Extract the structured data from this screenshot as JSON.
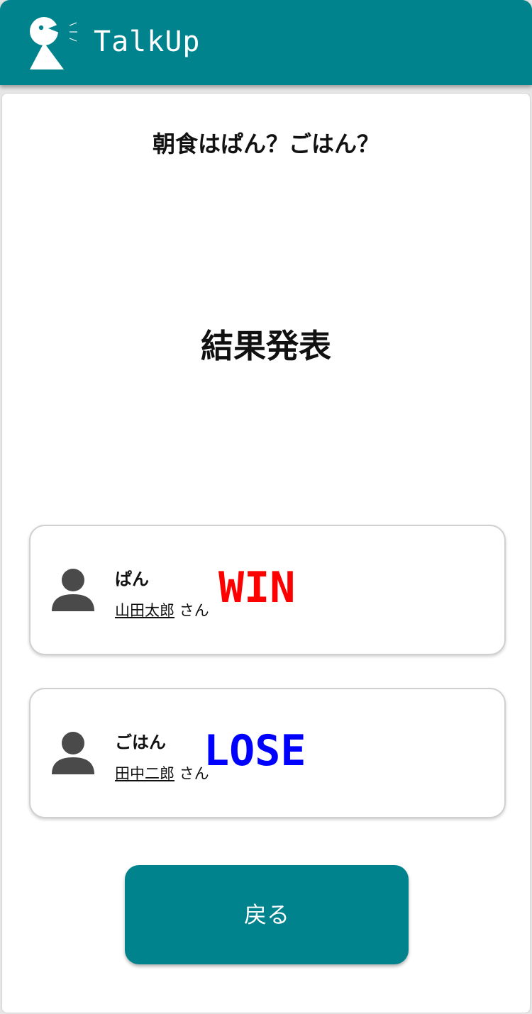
{
  "header": {
    "app_title": "TalkUp",
    "logo_icon": "speaking-person-logo-icon",
    "background_color": "#00838c"
  },
  "topic": {
    "title": "朝食はぱん？ごはん？"
  },
  "result": {
    "heading": "結果発表",
    "entries": [
      {
        "option": "ぱん",
        "user_name": "山田太郎",
        "honorific": " さん",
        "outcome": "WIN",
        "outcome_color": "#ff0000",
        "avatar_icon": "person-icon"
      },
      {
        "option": "ごはん",
        "user_name": "田中二郎",
        "honorific": " さん",
        "outcome": "LOSE",
        "outcome_color": "#0000ff",
        "avatar_icon": "person-icon"
      }
    ]
  },
  "actions": {
    "back_label": "戻る",
    "button_color": "#00838c"
  }
}
